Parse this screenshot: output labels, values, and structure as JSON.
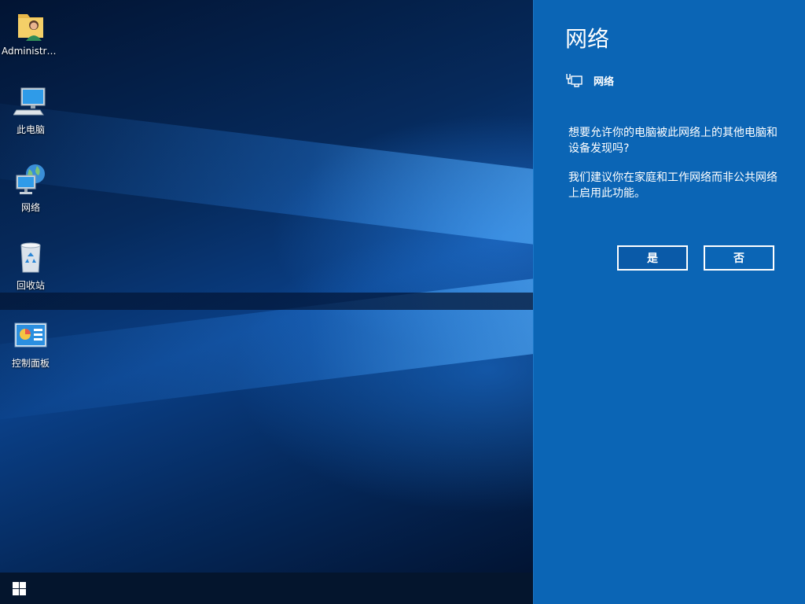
{
  "desktop": {
    "icons": [
      {
        "label": "Administra...",
        "icon": "user-folder-icon"
      },
      {
        "label": "此电脑",
        "icon": "computer-icon"
      },
      {
        "label": "网络",
        "icon": "network-icon"
      },
      {
        "label": "回收站",
        "icon": "recycle-bin-icon"
      },
      {
        "label": "控制面板",
        "icon": "control-panel-icon"
      }
    ]
  },
  "taskbar": {
    "start_icon": "windows-logo-icon"
  },
  "network_panel": {
    "title": "网络",
    "network_name": "网络",
    "network_icon": "ethernet-icon",
    "message1": "想要允许你的电脑被此网络上的其他电脑和设备发现吗?",
    "message2": "我们建议你在家庭和工作网络而非公共网络上启用此功能。",
    "yes_label": "是",
    "no_label": "否"
  },
  "colors": {
    "panel_bg": "#0b65b5",
    "taskbar_bg": "#04152d",
    "desktop_accent": "#1e7fd8"
  }
}
